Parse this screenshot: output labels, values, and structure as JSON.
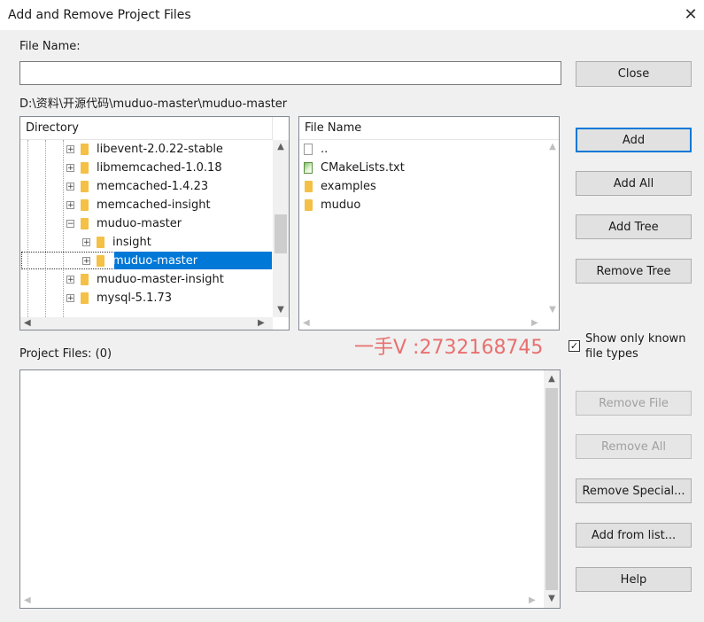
{
  "window": {
    "title": "Add and Remove Project Files",
    "close_glyph": "✕"
  },
  "file_name": {
    "label": "File Name:",
    "value": ""
  },
  "path": "D:\\资料\\开源代码\\muduo-master\\muduo-master",
  "directory": {
    "header": "Directory",
    "items": [
      {
        "label": "libevent-2.0.22-stable",
        "indent": 0,
        "selected": false
      },
      {
        "label": "libmemcached-1.0.18",
        "indent": 0,
        "selected": false
      },
      {
        "label": "memcached-1.4.23",
        "indent": 0,
        "selected": false
      },
      {
        "label": "memcached-insight",
        "indent": 0,
        "selected": false
      },
      {
        "label": "muduo-master",
        "indent": 0,
        "selected": false
      },
      {
        "label": "insight",
        "indent": 1,
        "selected": false
      },
      {
        "label": "muduo-master",
        "indent": 1,
        "selected": true
      },
      {
        "label": "muduo-master-insight",
        "indent": 0,
        "selected": false
      },
      {
        "label": "mysql-5.1.73",
        "indent": 0,
        "selected": false
      }
    ]
  },
  "files": {
    "header": "File Name",
    "items": [
      {
        "label": "..",
        "icon": "blank-file-icon"
      },
      {
        "label": "CMakeLists.txt",
        "icon": "text-file-icon"
      },
      {
        "label": "examples",
        "icon": "folder-icon"
      },
      {
        "label": "muduo",
        "icon": "folder-icon"
      }
    ]
  },
  "project_files": {
    "label": "Project Files: (0)"
  },
  "watermark": "一手V :2732168745",
  "show_known": {
    "label_line1": "Show only known",
    "label_line2": "file types",
    "checked": true
  },
  "buttons": {
    "close": "Close",
    "add": "Add",
    "add_all": "Add All",
    "add_tree": "Add Tree",
    "remove_tree": "Remove Tree",
    "remove_file": "Remove File",
    "remove_all": "Remove All",
    "remove_special": "Remove Special...",
    "add_from_list": "Add from list...",
    "help": "Help"
  },
  "colors": {
    "selection": "#0078d7",
    "folder": "#f4c045",
    "watermark": "#e87070"
  }
}
